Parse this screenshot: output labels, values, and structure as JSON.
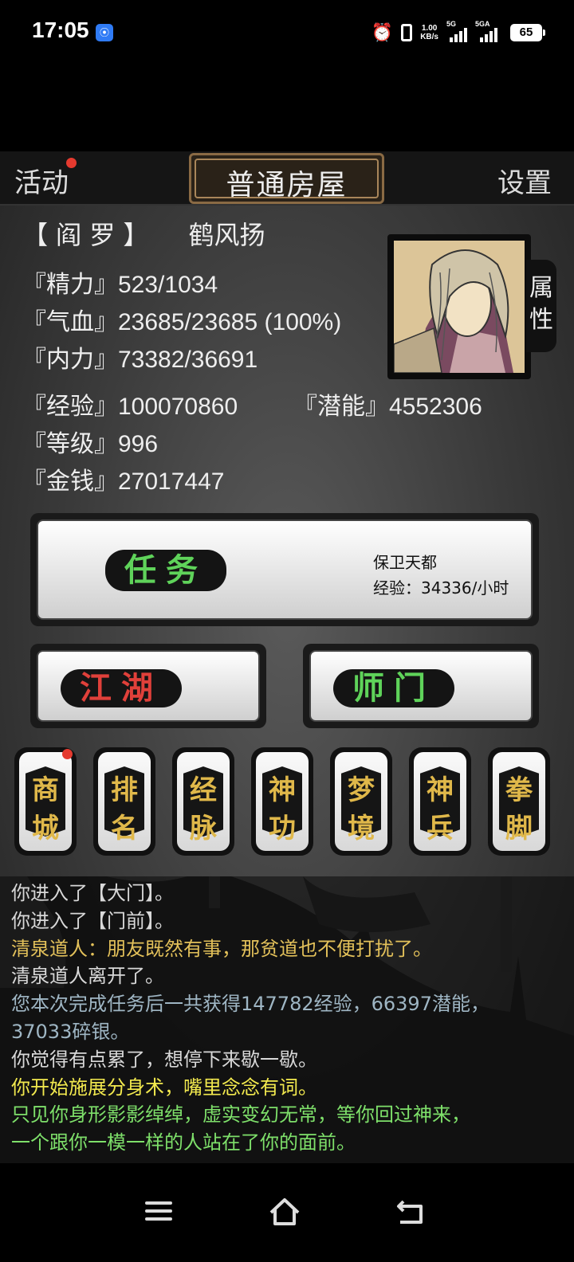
{
  "status_bar": {
    "time": "17:05",
    "net_speed": "1.00",
    "net_speed_unit": "KB/s",
    "sim1_label": "5G",
    "sim2_label": "5GA",
    "battery": "65",
    "icons": [
      "hotspot-icon",
      "alarm-icon",
      "vibrate-icon",
      "signal-icon",
      "battery-icon"
    ]
  },
  "topbar": {
    "activity_label": "活动",
    "title": "普通房屋",
    "settings_label": "设置"
  },
  "character": {
    "title": "【 阎 罗 】",
    "name": "鹤风扬",
    "attr_tab": "属性"
  },
  "stats": {
    "energy": "『精力』523/1034",
    "blood": "『气血』23685/23685 (100%)",
    "inner": "『内力』73382/36691",
    "exp": "『经验』100070860",
    "potential": "『潜能』4552306",
    "level": "『等级』996",
    "money": "『金钱』27017447"
  },
  "buttons": {
    "task_label": "任务",
    "task_name": "保卫天都",
    "task_exp": "经验：34336/小时",
    "jianghu_label": "江湖",
    "shimen_label": "师门"
  },
  "tiles": [
    {
      "label": "商\n城",
      "name": "shop"
    },
    {
      "label": "排\n名",
      "name": "ranking"
    },
    {
      "label": "经\n脉",
      "name": "meridians"
    },
    {
      "label": "神\n功",
      "name": "divine-skill"
    },
    {
      "label": "梦\n境",
      "name": "dream"
    },
    {
      "label": "神\n兵",
      "name": "divine-weapon"
    },
    {
      "label": "拳\n脚",
      "name": "fist-kick"
    }
  ],
  "log": [
    {
      "text": "你进入了【大门】。",
      "color": "#d8d8d8"
    },
    {
      "text": "你进入了【门前】。",
      "color": "#d8d8d8"
    },
    {
      "text": "清泉道人：朋友既然有事，那贫道也不便打扰了。",
      "color": "#e3c15a"
    },
    {
      "text": "清泉道人离开了。",
      "color": "#d8d8d8"
    },
    {
      "text": "您本次完成任务后一共获得147782经验，66397潜能，",
      "color": "#9fb6c4"
    },
    {
      "text": "37033碎银。",
      "color": "#9fb6c4"
    },
    {
      "text": "你觉得有点累了，想停下来歇一歇。",
      "color": "#d8d8d8"
    },
    {
      "text": "你开始施展分身术，嘴里念念有词。",
      "color": "#f2e94e"
    },
    {
      "text": "只见你身形影影绰绰，虚实变幻无常，等你回过神来，",
      "color": "#7ee06a"
    },
    {
      "text": "一个跟你一模一样的人站在了你的面前。",
      "color": "#7ee06a"
    }
  ],
  "colors": {
    "task_green": "#5fd35a",
    "jianghu_red": "#e0403a",
    "shimen_green": "#5fd35a",
    "tile_gold": "#e0b84a",
    "badge_red": "#e53a2f"
  },
  "navbar": {
    "icons": [
      "menu-icon",
      "home-icon",
      "back-icon"
    ]
  }
}
